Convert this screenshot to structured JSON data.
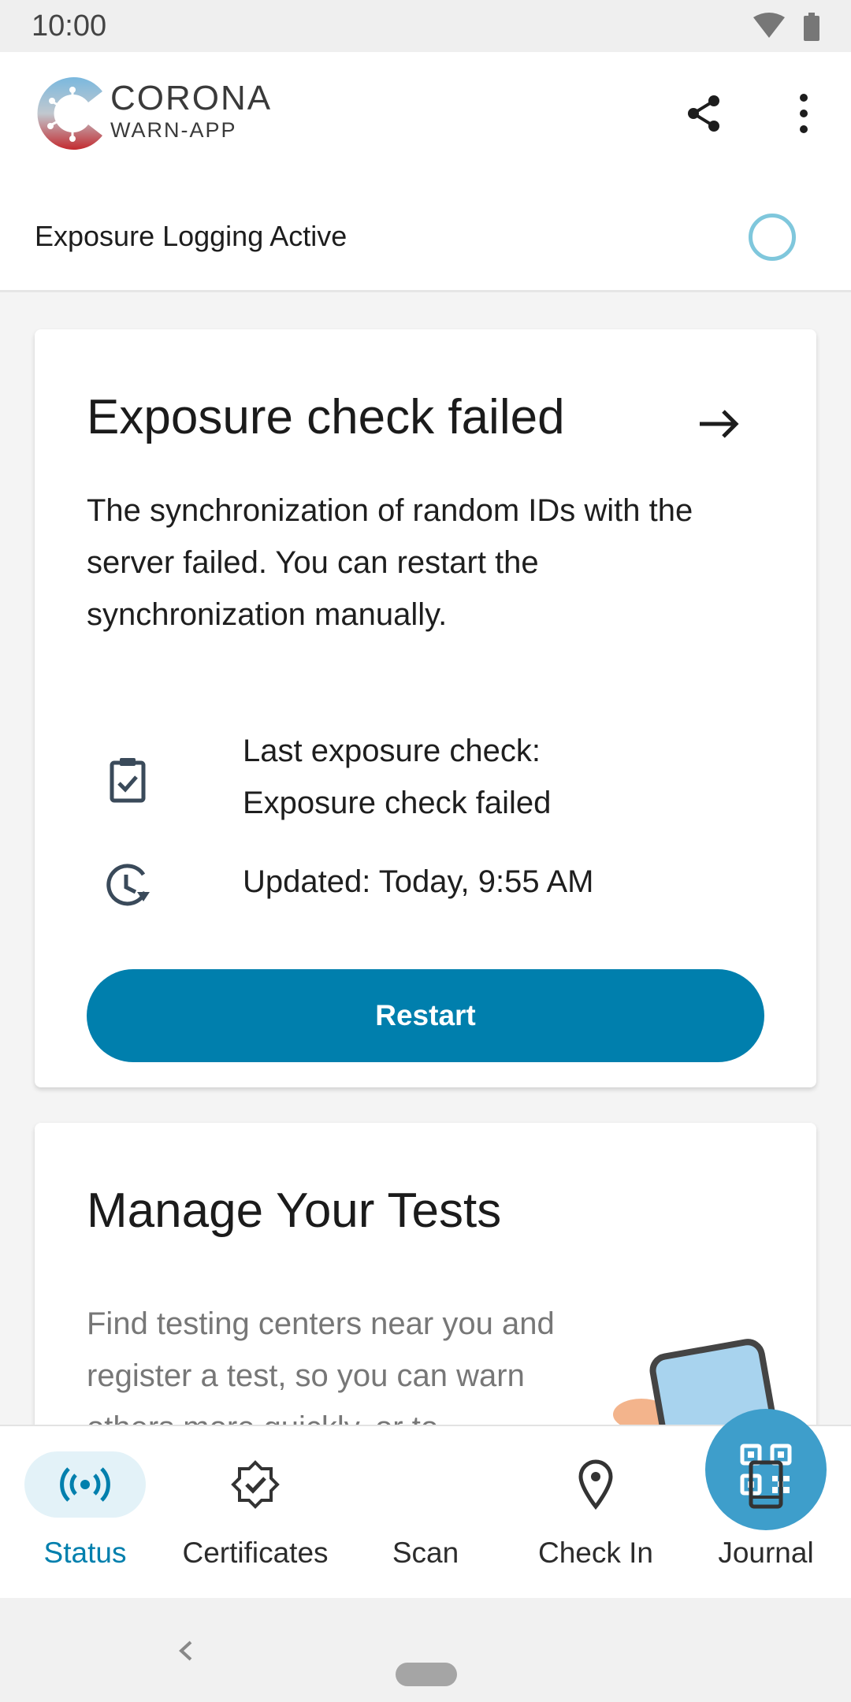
{
  "status_bar": {
    "time": "10:00"
  },
  "app": {
    "brand_line1": "CORONA",
    "brand_line2": "WARN-APP",
    "brand_colors": [
      "#3a8fc4",
      "#c0282e"
    ]
  },
  "header": {
    "exposure_logging_label": "Exposure Logging Active",
    "status_color": "#7fc7dc"
  },
  "exposure_card": {
    "title": "Exposure check failed",
    "description": "The synchronization of random IDs with the server failed. You can restart the synchronization manually.",
    "last_check_label": "Last exposure check:",
    "last_check_value": "Exposure check failed",
    "updated": "Updated: Today, 9:55 AM",
    "button_label": "Restart",
    "button_color": "#007fad"
  },
  "tests_card": {
    "title": "Manage Your Tests",
    "description": "Find testing centers near you and register a test, so you can warn others more quickly, or to"
  },
  "bottom_nav": {
    "items": [
      {
        "label": "Status",
        "icon": "broadcast-icon",
        "active": true
      },
      {
        "label": "Certificates",
        "icon": "certificate-badge-icon",
        "active": false
      },
      {
        "label": "Scan",
        "icon": "qr-code-icon",
        "active": false
      },
      {
        "label": "Check In",
        "icon": "location-pin-icon",
        "active": false
      },
      {
        "label": "Journal",
        "icon": "book-icon",
        "active": false
      }
    ],
    "accent_color": "#007fad"
  }
}
